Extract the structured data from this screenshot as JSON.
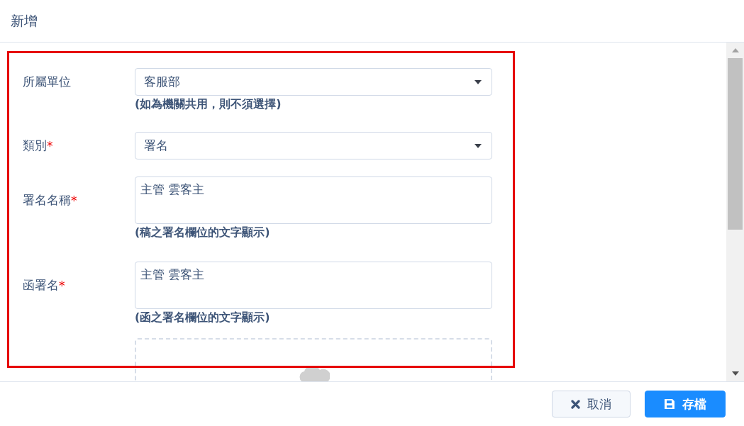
{
  "dialog": {
    "title": "新增"
  },
  "fields": [
    {
      "kind": "select",
      "label": "所屬單位",
      "value": "客服部",
      "hint": "(如為機關共用，則不須選擇)"
    },
    {
      "kind": "select",
      "label": "類別",
      "required_mark": "*",
      "value": "署名"
    },
    {
      "kind": "textarea",
      "label": "署名名稱",
      "required_mark": "*",
      "value": "主管 雲客主",
      "hint": "(稿之署名欄位的文字顯示)"
    },
    {
      "kind": "textarea",
      "label": "函署名",
      "required_mark": "*",
      "value": "主管 雲客主",
      "hint": "(函之署名欄位的文字顯示)"
    },
    {
      "kind": "upload"
    }
  ],
  "buttons": [
    {
      "kind": "cancel",
      "label": "取消"
    },
    {
      "kind": "save",
      "label": "存檔"
    }
  ]
}
